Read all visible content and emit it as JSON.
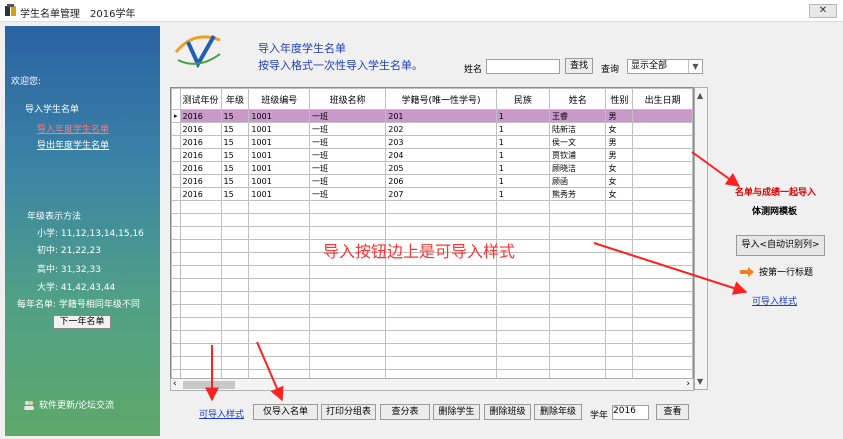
{
  "window": {
    "title": "学生名单管理　2016学年",
    "close_label": "✕"
  },
  "sidebar": {
    "welcome": "欢迎您:",
    "section_title": "导入学生名单",
    "link_import": "导入年度学生名单",
    "link_export": "导出年度学生名单",
    "grade_title": "年级表示方法",
    "grades": [
      "小学: 11,12,13,14,15,16",
      "初中: 21,22,23",
      "高中: 31,32,33",
      "大学: 41,42,43,44",
      "每年名单: 学籍号相同年级不同"
    ],
    "next_year_button": "下一年名单",
    "forum": "软件更新/论坛交流"
  },
  "header": {
    "line1": "导入年度学生名单",
    "line2": "按导入格式一次性导入学生名单。",
    "name_label": "姓名",
    "name_value": "",
    "search_button": "查找",
    "query_label": "查询",
    "query_value": "显示全部"
  },
  "table": {
    "columns": [
      "测试年份",
      "年级",
      "班级编号",
      "班级名称",
      "学籍号(唯一性学号)",
      "民族",
      "姓名",
      "性别",
      "出生日期"
    ],
    "rows": [
      [
        "2016",
        "15",
        "1001",
        "一班",
        "201",
        "1",
        "王睿",
        "男",
        ""
      ],
      [
        "2016",
        "15",
        "1001",
        "一班",
        "202",
        "1",
        "陆新洁",
        "女",
        ""
      ],
      [
        "2016",
        "15",
        "1001",
        "一班",
        "203",
        "1",
        "侯一文",
        "男",
        ""
      ],
      [
        "2016",
        "15",
        "1001",
        "一班",
        "204",
        "1",
        "贾钦浦",
        "男",
        ""
      ],
      [
        "2016",
        "15",
        "1001",
        "一班",
        "205",
        "1",
        "顾晓洁",
        "女",
        ""
      ],
      [
        "2016",
        "15",
        "1001",
        "一班",
        "206",
        "1",
        "顾函",
        "女",
        ""
      ],
      [
        "2016",
        "15",
        "1001",
        "一班",
        "207",
        "1",
        "熊秀芳",
        "女",
        ""
      ]
    ],
    "selected_row": 0,
    "empty_rows": 14
  },
  "right_panel": {
    "note": "名单与成绩一起导入",
    "template": "体测网模板",
    "import_button": "导入<自动识别列>",
    "first_row_title": "按第一行标题",
    "import_sample_link": "可导入样式"
  },
  "overlay_text": "导入按钮边上是可导入样式",
  "bottom": {
    "import_sample_link": "可导入样式",
    "buttons": [
      "仅导入名单",
      "打印分组表",
      "查分表",
      "删除学生",
      "删除班级",
      "删除年级"
    ],
    "year_label": "学年",
    "year_value": "2016",
    "view_button": "查看"
  },
  "colors": {
    "selected_row": "#c999c9",
    "annotation_red": "#ff3333",
    "link_blue": "#1a3fd0"
  }
}
